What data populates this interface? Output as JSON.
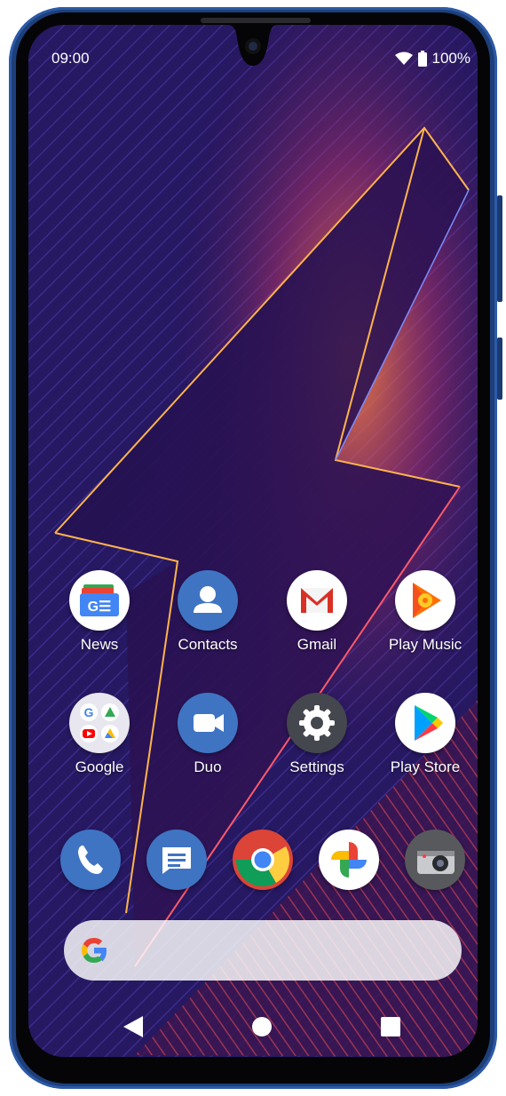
{
  "status_bar": {
    "time": "09:00",
    "battery": "100%"
  },
  "apps_row1": [
    {
      "label": "News",
      "icon": "google-news-icon"
    },
    {
      "label": "Contacts",
      "icon": "contacts-icon"
    },
    {
      "label": "Gmail",
      "icon": "gmail-icon"
    },
    {
      "label": "Play Music",
      "icon": "play-music-icon"
    }
  ],
  "apps_row2": [
    {
      "label": "Google",
      "icon": "google-folder-icon"
    },
    {
      "label": "Duo",
      "icon": "duo-icon"
    },
    {
      "label": "Settings",
      "icon": "gear-icon"
    },
    {
      "label": "Play Store",
      "icon": "play-store-icon"
    }
  ],
  "dock": [
    "phone-icon",
    "messages-icon",
    "chrome-icon",
    "photos-icon",
    "camera-icon"
  ],
  "search": {
    "logo": "G"
  },
  "colors": {
    "frame": "#1d3f7a",
    "wallpaper": "#24135a",
    "accent": "#ffb34d"
  }
}
